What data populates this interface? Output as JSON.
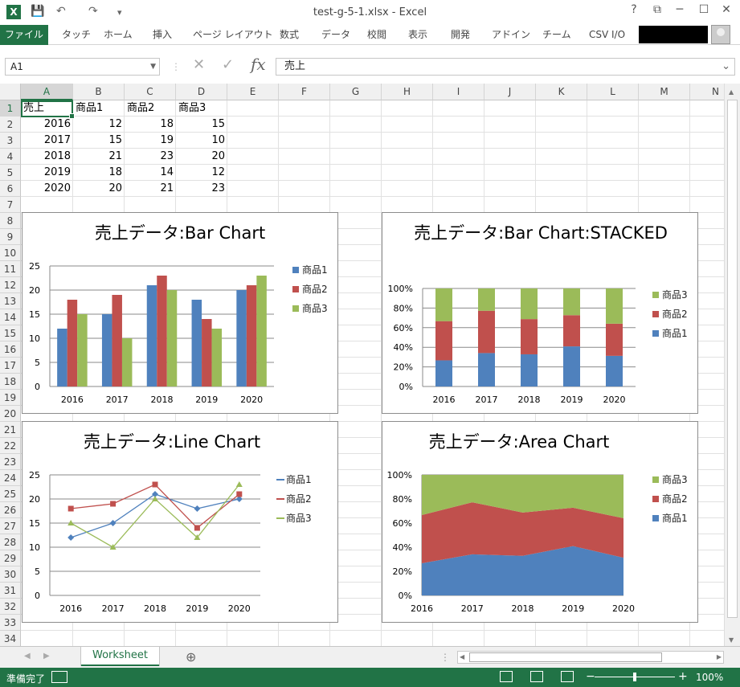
{
  "window": {
    "title": "test-g-5-1.xlsx - Excel",
    "app_badge": "X",
    "help": "?",
    "restore_ribbon": "⧉",
    "minimize": "─",
    "maximize": "☐",
    "close": "✕"
  },
  "qat": {
    "save": "💾",
    "undo": "↶",
    "redo": "↷",
    "customize": "▾"
  },
  "ribbon": {
    "file": "ファイル",
    "tabs": [
      "タッチ",
      "ホーム",
      "挿入",
      "ページ レイアウト",
      "数式",
      "データ",
      "校閲",
      "表示",
      "開発",
      "アドイン",
      "チーム",
      "CSV I/O"
    ]
  },
  "formula_bar": {
    "name_box": "A1",
    "content": "売上",
    "cancel": "✕",
    "enter": "✓",
    "fx": "fx"
  },
  "columns": [
    "A",
    "B",
    "C",
    "D",
    "E",
    "F",
    "G",
    "H",
    "I",
    "J",
    "K",
    "L",
    "M",
    "N"
  ],
  "rows": [
    "1",
    "2",
    "3",
    "4",
    "5",
    "6",
    "7",
    "8",
    "9",
    "10",
    "11",
    "12",
    "13",
    "14",
    "15",
    "16",
    "17",
    "18",
    "19",
    "20",
    "21",
    "22",
    "23",
    "24",
    "25",
    "26",
    "27",
    "28",
    "29",
    "30",
    "31",
    "32",
    "33",
    "34"
  ],
  "table": {
    "headers": [
      "売上",
      "商品1",
      "商品2",
      "商品3"
    ],
    "rows": [
      [
        "2016",
        "12",
        "18",
        "15"
      ],
      [
        "2017",
        "15",
        "19",
        "10"
      ],
      [
        "2018",
        "21",
        "23",
        "20"
      ],
      [
        "2019",
        "18",
        "14",
        "12"
      ],
      [
        "2020",
        "20",
        "21",
        "23"
      ]
    ]
  },
  "chart_data": [
    {
      "type": "bar",
      "title": "売上データ:Bar Chart",
      "categories": [
        "2016",
        "2017",
        "2018",
        "2019",
        "2020"
      ],
      "series": [
        {
          "name": "商品1",
          "values": [
            12,
            15,
            21,
            18,
            20
          ]
        },
        {
          "name": "商品2",
          "values": [
            18,
            19,
            23,
            14,
            21
          ]
        },
        {
          "name": "商品3",
          "values": [
            15,
            10,
            20,
            12,
            23
          ]
        }
      ],
      "ylim": [
        0,
        25
      ],
      "yticks": [
        "0",
        "5",
        "10",
        "15",
        "20",
        "25"
      ],
      "grid": true,
      "legend": "right"
    },
    {
      "type": "bar",
      "stacking": "percent",
      "title": "売上データ:Bar Chart:STACKED",
      "categories": [
        "2016",
        "2017",
        "2018",
        "2019",
        "2020"
      ],
      "series": [
        {
          "name": "商品1",
          "values": [
            12,
            15,
            21,
            18,
            20
          ]
        },
        {
          "name": "商品2",
          "values": [
            18,
            19,
            23,
            14,
            21
          ]
        },
        {
          "name": "商品3",
          "values": [
            15,
            10,
            20,
            12,
            23
          ]
        }
      ],
      "ylim": [
        0,
        100
      ],
      "yticks": [
        "0%",
        "20%",
        "40%",
        "60%",
        "80%",
        "100%"
      ],
      "grid": true,
      "legend": "right"
    },
    {
      "type": "line",
      "title": "売上データ:Line Chart",
      "categories": [
        "2016",
        "2017",
        "2018",
        "2019",
        "2020"
      ],
      "series": [
        {
          "name": "商品1",
          "values": [
            12,
            15,
            21,
            18,
            20
          ]
        },
        {
          "name": "商品2",
          "values": [
            18,
            19,
            23,
            14,
            21
          ]
        },
        {
          "name": "商品3",
          "values": [
            15,
            10,
            20,
            12,
            23
          ]
        }
      ],
      "ylim": [
        0,
        25
      ],
      "yticks": [
        "0",
        "5",
        "10",
        "15",
        "20",
        "25"
      ],
      "grid": true,
      "legend": "right"
    },
    {
      "type": "area",
      "stacking": "percent",
      "title": "売上データ:Area Chart",
      "categories": [
        "2016",
        "2017",
        "2018",
        "2019",
        "2020"
      ],
      "series": [
        {
          "name": "商品1",
          "values": [
            12,
            15,
            21,
            18,
            20
          ]
        },
        {
          "name": "商品2",
          "values": [
            18,
            19,
            23,
            14,
            21
          ]
        },
        {
          "name": "商品3",
          "values": [
            15,
            10,
            20,
            12,
            23
          ]
        }
      ],
      "ylim": [
        0,
        100
      ],
      "yticks": [
        "0%",
        "20%",
        "40%",
        "60%",
        "80%",
        "100%"
      ],
      "grid": true,
      "legend": "right"
    }
  ],
  "colors": {
    "series": [
      "#4f81bd",
      "#c0504d",
      "#9bbb59"
    ],
    "accent": "#217346"
  },
  "sheet_tabs": {
    "active": "Worksheet",
    "add": "⊕"
  },
  "status": {
    "text": "準備完了",
    "zoom": "100%",
    "zoom_fraction": 0.5,
    "minus": "−",
    "plus": "+"
  }
}
